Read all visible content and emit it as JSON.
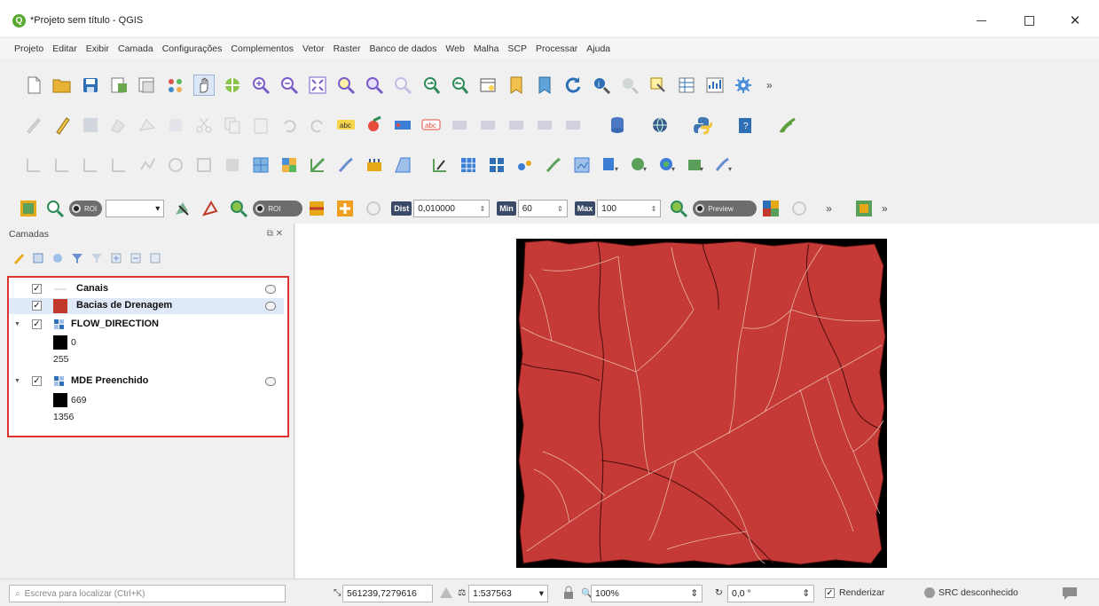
{
  "window": {
    "title": "*Projeto sem título - QGIS",
    "app_logo": "Q"
  },
  "menubar": [
    "Projeto",
    "Editar",
    "Exibir",
    "Camada",
    "Configurações",
    "Complementos",
    "Vetor",
    "Raster",
    "Banco de dados",
    "Web",
    "Malha",
    "SCP",
    "Processar",
    "Ajuda"
  ],
  "scp_toolbar": {
    "roi_label": "ROI",
    "dist_label": "Dist",
    "dist_value": "0,010000",
    "min_label": "Min",
    "min_value": "60",
    "max_label": "Max",
    "max_value": "100",
    "preview_label": "Preview",
    "overflow": "»"
  },
  "layers": {
    "title": "Camadas",
    "items": [
      {
        "name": "Canais",
        "checked": "✓"
      },
      {
        "name": "Bacias de Drenagem",
        "checked": "✓",
        "swatch_color": "#c0392b"
      },
      {
        "name": "FLOW_DIRECTION",
        "checked": "✓",
        "legend_min": "0",
        "legend_max": "255"
      },
      {
        "name": "MDE Preenchido",
        "checked": "✓",
        "legend_min": "669",
        "legend_max": "1356"
      }
    ]
  },
  "statusbar": {
    "search_placeholder": "Escreva para localizar (Ctrl+K)",
    "coordinate": "561239,7279616",
    "scale": "1:537563",
    "magnifier": "100%",
    "rotation": "0,0 °",
    "render_label": "Renderizar",
    "crs_label": "SRC desconhecido"
  },
  "colors": {
    "basin_red": "#c0392b",
    "drainage_lines": "#e8b4a8",
    "nodata_black": "#000000",
    "highlight_box": "#e03131"
  }
}
